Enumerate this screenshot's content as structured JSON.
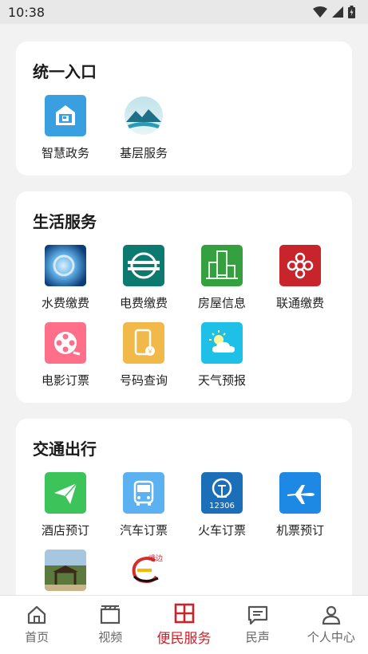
{
  "status": {
    "time": "10:38"
  },
  "sections": [
    {
      "title": "统一入口",
      "items": [
        {
          "label": "智慧政务",
          "icon": "gov-building-icon"
        },
        {
          "label": "基层服务",
          "icon": "mountain-logo-icon"
        }
      ]
    },
    {
      "title": "生活服务",
      "items": [
        {
          "label": "水费缴费",
          "icon": "water-icon"
        },
        {
          "label": "电费缴费",
          "icon": "state-grid-icon"
        },
        {
          "label": "房屋信息",
          "icon": "building-icon"
        },
        {
          "label": "联通缴费",
          "icon": "unicom-knot-icon"
        },
        {
          "label": "电影订票",
          "icon": "film-reel-icon"
        },
        {
          "label": "号码查询",
          "icon": "phone-lookup-icon"
        },
        {
          "label": "天气预报",
          "icon": "weather-icon"
        }
      ]
    },
    {
      "title": "交通出行",
      "items": [
        {
          "label": "酒店预订",
          "icon": "paper-plane-icon"
        },
        {
          "label": "汽车订票",
          "icon": "bus-icon"
        },
        {
          "label": "火车订票",
          "icon": "railway-12306-icon",
          "badge": "12306"
        },
        {
          "label": "机票预订",
          "icon": "airplane-icon"
        },
        {
          "label": "",
          "icon": "scenic-gate-icon"
        },
        {
          "label": "",
          "icon": "e-logo-icon",
          "badge": "峨边"
        }
      ]
    }
  ],
  "tabs": [
    {
      "label": "首页",
      "icon": "home-icon"
    },
    {
      "label": "视频",
      "icon": "video-icon"
    },
    {
      "label": "便民服务",
      "icon": "grid-icon",
      "active": true
    },
    {
      "label": "民声",
      "icon": "message-icon"
    },
    {
      "label": "个人中心",
      "icon": "person-icon"
    }
  ],
  "colors": {
    "accent": "#c8242c",
    "background": "#f2f2f2"
  }
}
